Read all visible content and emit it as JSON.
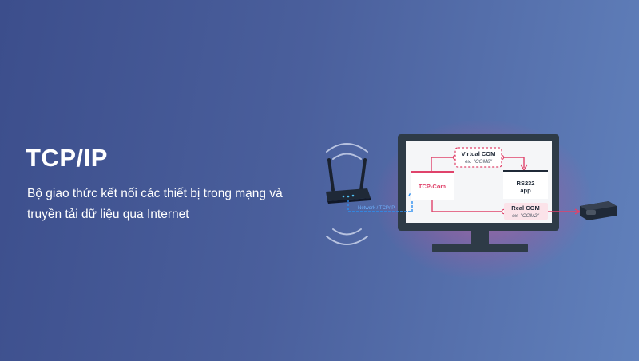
{
  "heading": {
    "title": "TCP/IP",
    "subtitle": "Bộ giao thức kết nối các thiết bị trong mạng và truyền tải dữ liệu qua Internet"
  },
  "diagram": {
    "virtual_com": {
      "label": "Virtual COM",
      "example": "ex. \"COM8\""
    },
    "tcp_com": {
      "label": "TCP-Com"
    },
    "rs232_app": {
      "line1": "RS232",
      "line2": "app"
    },
    "real_com": {
      "label": "Real COM",
      "example": "ex. \"COM2\""
    },
    "link_label": "Network / TCP/IP"
  },
  "colors": {
    "accent_red": "#e0436b",
    "link_blue": "#2c8ef0",
    "monitor_frame": "#2e3b47",
    "screen_bg": "#f5f6f8"
  },
  "icons": [
    "router-icon",
    "wifi-waves-icon",
    "serial-device-icon",
    "monitor-icon"
  ]
}
